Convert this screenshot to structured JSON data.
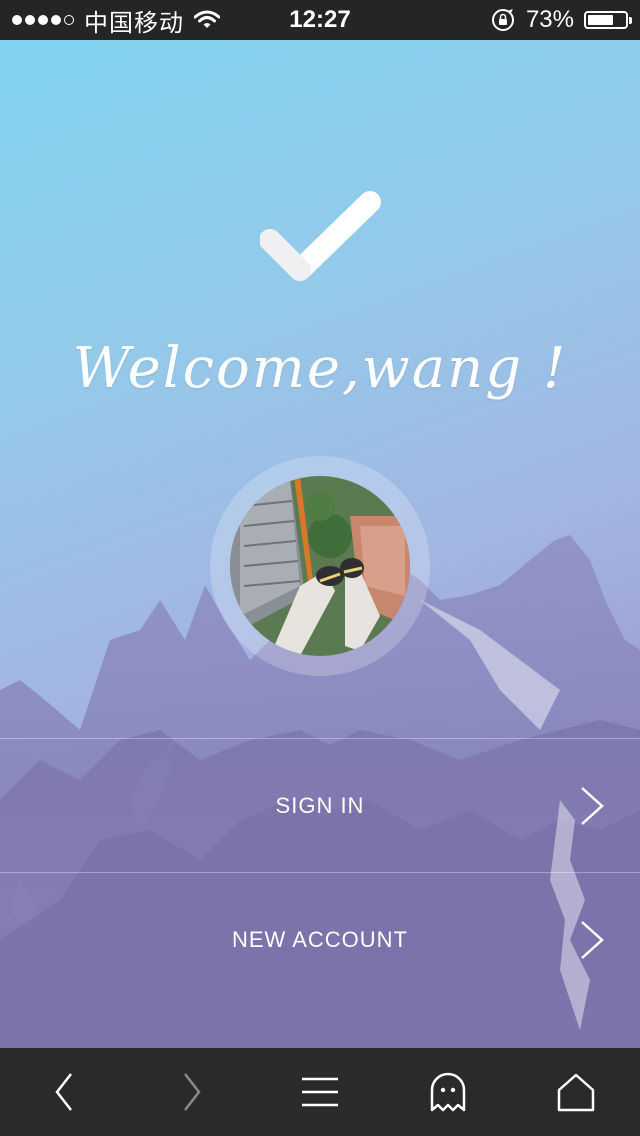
{
  "status_bar": {
    "carrier": "中国移动",
    "time": "12:27",
    "battery_text": "73%",
    "battery_level": 0.73,
    "signal_bars": 4,
    "signal_total": 5,
    "icons": [
      "wifi-icon",
      "orientation-lock-icon",
      "battery-icon"
    ]
  },
  "hero": {
    "icon": "checkmark-icon",
    "welcome_text": "Welcome,wang !"
  },
  "avatar": {
    "icon": "avatar-photo"
  },
  "actions": {
    "sign_in": {
      "label": "SIGN IN",
      "icon": "chevron-right-icon"
    },
    "new_account": {
      "label": "NEW ACCOUNT",
      "icon": "chevron-right-icon"
    }
  },
  "toolbar": {
    "icons": [
      "back-icon",
      "forward-icon",
      "menu-icon",
      "ghost-icon",
      "home-icon"
    ]
  },
  "colors": {
    "gradient_top": "#7fd3ee",
    "gradient_bottom": "#8c7fbe",
    "toolbar_bg": "#2a2a2c",
    "status_bar_bg": "#252525",
    "text": "#ffffff"
  }
}
